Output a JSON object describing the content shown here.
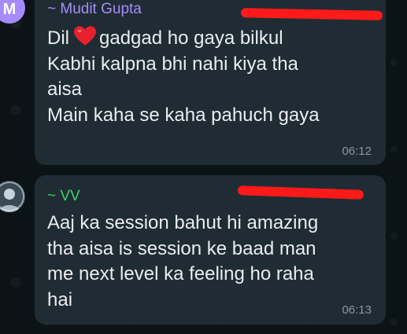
{
  "messages": [
    {
      "avatar_letter": "M",
      "sender": "~ Mudit Gupta",
      "sender_color": "#a78bfa",
      "lines": [
        {
          "before_emoji": "Dil",
          "emoji": "red-heart",
          "after_emoji": "gadgad ho gaya bilkul"
        },
        "Kabhi kalpna bhi nahi kiya tha",
        "aisa",
        "Main kaha se kaha pahuch gaya"
      ],
      "time": "06:12"
    },
    {
      "sender": "~ VV",
      "sender_color": "#3ccf6a",
      "lines": [
        "Aaj ka session bahut hi amazing",
        "tha aisa is session ke baad man",
        "me next level ka feeling ho raha",
        "hai"
      ],
      "time": "06:13"
    }
  ],
  "colors": {
    "background": "#0b141a",
    "bubble": "#202c33",
    "text": "#e9edef",
    "meta": "#8696a0",
    "redaction": "#ff1a1a"
  }
}
